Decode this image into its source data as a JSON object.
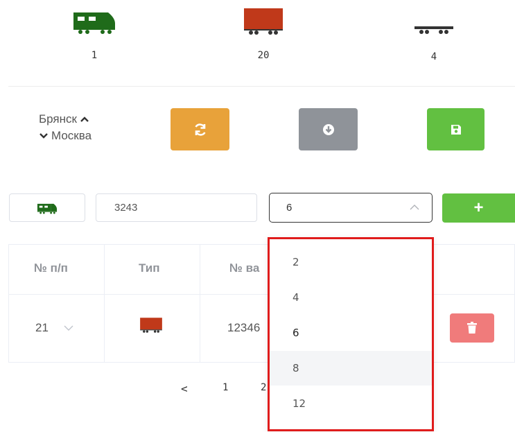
{
  "vehicles": [
    {
      "icon": "locomotive-icon",
      "count": "1"
    },
    {
      "icon": "boxcar-icon",
      "count": "20"
    },
    {
      "icon": "flatcar-icon",
      "count": "4"
    }
  ],
  "route": {
    "from": "Брянск",
    "to": "Москва"
  },
  "actions": {
    "refresh": "refresh-icon",
    "download": "download-icon",
    "save": "save-icon"
  },
  "form": {
    "type_icon": "locomotive-icon",
    "number_value": "3243",
    "count_value": "6",
    "add_label": "+"
  },
  "table": {
    "columns": [
      "№ п/п",
      "Тип",
      "№ ва"
    ],
    "rows": [
      {
        "index": "21",
        "type_icon": "boxcar-icon",
        "number": "12346"
      }
    ]
  },
  "pagination": {
    "prev": "<",
    "pages": [
      "1",
      "2"
    ]
  },
  "dropdown": {
    "options": [
      "2",
      "4",
      "6",
      "8",
      "12"
    ],
    "selected": "6",
    "hovered": "8"
  },
  "colors": {
    "green": "#1f6b1a",
    "brick": "#c0391a",
    "orange": "#e8a23a",
    "gray": "#8f9399",
    "light_green": "#62c041",
    "red": "#f07b7b",
    "highlight": "#e01b1b"
  }
}
